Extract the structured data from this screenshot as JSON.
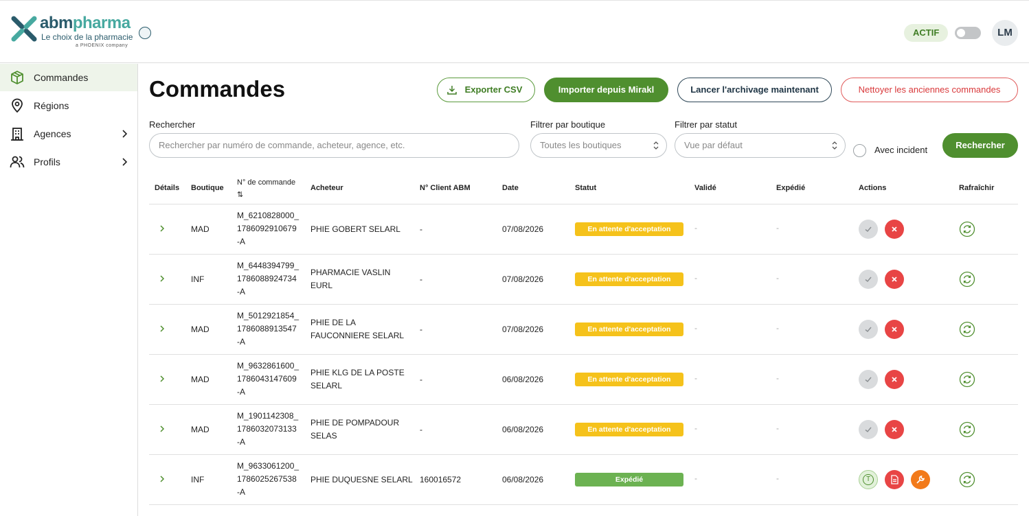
{
  "header": {
    "logo": {
      "name_part1": "abm",
      "name_part2": "pharma",
      "tagline": "Le choix de la pharmacie",
      "subline": "a PHOENIX company"
    },
    "status_pill": "ACTIF",
    "avatar_initials": "LM"
  },
  "sidebar": {
    "items": [
      {
        "label": "Commandes",
        "icon": "box-icon",
        "active": true
      },
      {
        "label": "Régions",
        "icon": "map-pin-icon"
      },
      {
        "label": "Agences",
        "icon": "building-icon",
        "has_submenu": true
      },
      {
        "label": "Profils",
        "icon": "users-icon",
        "has_submenu": true
      }
    ]
  },
  "main": {
    "title": "Commandes",
    "buttons": {
      "export": "Exporter CSV",
      "import": "Importer depuis Mirakl",
      "archive": "Lancer l'archivage maintenant",
      "clean": "Nettoyer les anciennes commandes",
      "search": "Rechercher"
    },
    "filters": {
      "search_label": "Rechercher",
      "search_placeholder": "Rechercher par numéro de commande, acheteur, agence, etc.",
      "shop_label": "Filtrer par boutique",
      "shop_value": "Toutes les boutiques",
      "status_label": "Filtrer par statut",
      "status_value": "Vue par défaut",
      "incident_label": "Avec incident"
    },
    "table": {
      "headers": {
        "details": "Détails",
        "boutique": "Boutique",
        "order_no": "N° de commande",
        "sort_glyph": "⇅",
        "buyer": "Acheteur",
        "client_no": "N° Client ABM",
        "date": "Date",
        "status": "Statut",
        "validated": "Validé",
        "shipped": "Expédié",
        "actions": "Actions",
        "refresh": "Rafraîchir"
      },
      "rows": [
        {
          "shop": "MAD",
          "order_l1": "M_6210828000_",
          "order_l2": "1786092910679",
          "order_l3": "-A",
          "buyer_l1": "PHIE GOBERT SELARL",
          "buyer_l2": "",
          "client": "-",
          "date": "07/08/2026",
          "status": "En attente d'acceptation",
          "validated": "-",
          "shipped": "-"
        },
        {
          "shop": "INF",
          "order_l1": "M_6448394799_",
          "order_l2": "1786088924734",
          "order_l3": "-A",
          "buyer_l1": "PHARMACIE VASLIN",
          "buyer_l2": "EURL",
          "client": "-",
          "date": "07/08/2026",
          "status": "En attente d'acceptation",
          "validated": "-",
          "shipped": "-"
        },
        {
          "shop": "MAD",
          "order_l1": "M_5012921854_",
          "order_l2": "1786088913547",
          "order_l3": "-A",
          "buyer_l1": "PHIE DE LA",
          "buyer_l2": "FAUCONNIERE SELARL",
          "client": "-",
          "date": "07/08/2026",
          "status": "En attente d'acceptation",
          "validated": "-",
          "shipped": "-"
        },
        {
          "shop": "MAD",
          "order_l1": "M_9632861600_",
          "order_l2": "1786043147609",
          "order_l3": "-A",
          "buyer_l1": "PHIE KLG DE LA POSTE",
          "buyer_l2": "SELARL",
          "client": "-",
          "date": "06/08/2026",
          "status": "En attente d'acceptation",
          "validated": "-",
          "shipped": "-"
        },
        {
          "shop": "MAD",
          "order_l1": "M_1901142308_",
          "order_l2": "1786032073133",
          "order_l3": "-A",
          "buyer_l1": "PHIE DE POMPADOUR",
          "buyer_l2": "SELAS",
          "client": "-",
          "date": "06/08/2026",
          "status": "En attente d'acceptation",
          "validated": "-",
          "shipped": "-"
        },
        {
          "shop": "INF",
          "order_l1": "M_9633061200_",
          "order_l2": "1786025267538",
          "order_l3": "-A",
          "buyer_l1": "PHIE DUQUESNE SELARL",
          "buyer_l2": "",
          "client": "160016572",
          "date": "06/08/2026",
          "status": "Expédié",
          "validated": "-",
          "shipped": "-"
        }
      ],
      "tracking_letter": "T"
    }
  },
  "colors": {
    "primary_green": "#4f8f2f",
    "warning_yellow": "#f5c21b",
    "shipped_green": "#6cb252",
    "danger_red": "#e84545",
    "tool_orange": "#f27a1a"
  }
}
